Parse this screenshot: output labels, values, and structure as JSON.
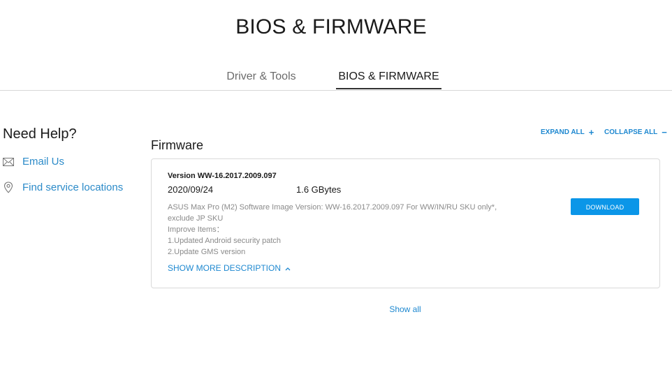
{
  "page": {
    "title": "BIOS & FIRMWARE"
  },
  "tabs": [
    {
      "label": "Driver & Tools",
      "active": false
    },
    {
      "label": "BIOS & FIRMWARE",
      "active": true
    }
  ],
  "help": {
    "title": "Need Help?",
    "email_label": "Email Us",
    "email_icon": "envelope-icon",
    "locations_label": "Find service locations",
    "locations_icon": "map-pin-icon"
  },
  "controls": {
    "expand_all": "EXPAND ALL",
    "expand_symbol": "+",
    "collapse_all": "COLLAPSE ALL",
    "collapse_symbol": "−"
  },
  "section": {
    "title": "Firmware"
  },
  "firmware_item": {
    "version": "Version WW-16.2017.2009.097",
    "date": "2020/09/24",
    "size": "1.6 GBytes",
    "description_lines": [
      "ASUS Max Pro (M2) Software Image Version: WW-16.2017.2009.097 For WW/IN/RU SKU only*,",
      "exclude JP SKU",
      "Improve Items：",
      "1.Updated Android security patch",
      "2.Update GMS version"
    ],
    "show_more_label": "SHOW MORE DESCRIPTION",
    "download_label": "DOWNLOAD"
  },
  "footer": {
    "show_all_label": "Show all"
  },
  "colors": {
    "accent": "#1e88d0",
    "button": "#0b96e8",
    "muted_text": "#8a8a8a"
  }
}
